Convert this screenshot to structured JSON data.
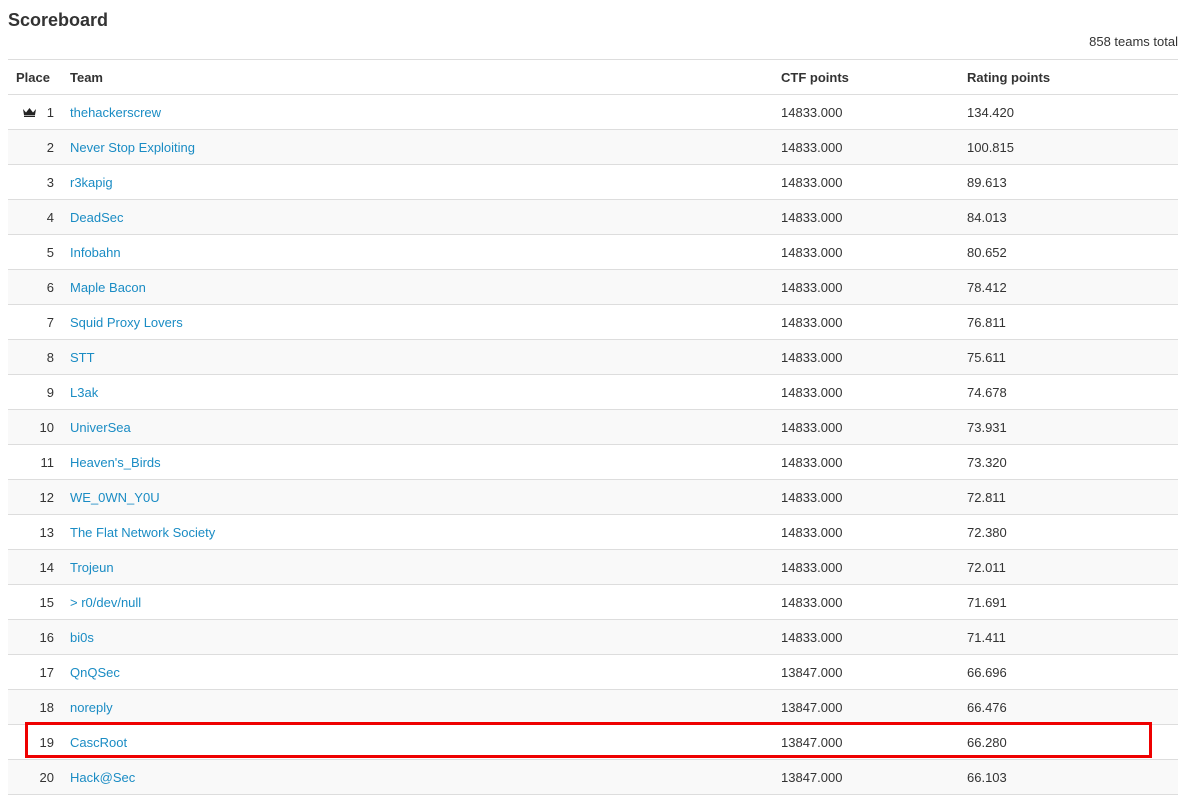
{
  "page": {
    "title": "Scoreboard",
    "teams_total": "858 teams total"
  },
  "colors": {
    "link": "#1a8cc4",
    "highlight": "#ee0000",
    "row_stripe": "#f9f9f9",
    "border": "#dddddd"
  },
  "table": {
    "headers": {
      "place": "Place",
      "team": "Team",
      "ctf_points": "CTF points",
      "rating_points": "Rating points"
    },
    "rows": [
      {
        "place": "1",
        "team": "thehackerscrew",
        "ctf": "14833.000",
        "rating": "134.420",
        "icon": "crown-icon"
      },
      {
        "place": "2",
        "team": "Never Stop Exploiting",
        "ctf": "14833.000",
        "rating": "100.815"
      },
      {
        "place": "3",
        "team": "r3kapig",
        "ctf": "14833.000",
        "rating": "89.613"
      },
      {
        "place": "4",
        "team": "DeadSec",
        "ctf": "14833.000",
        "rating": "84.013"
      },
      {
        "place": "5",
        "team": "Infobahn",
        "ctf": "14833.000",
        "rating": "80.652"
      },
      {
        "place": "6",
        "team": "Maple Bacon",
        "ctf": "14833.000",
        "rating": "78.412"
      },
      {
        "place": "7",
        "team": "Squid Proxy Lovers",
        "ctf": "14833.000",
        "rating": "76.811"
      },
      {
        "place": "8",
        "team": "STT",
        "ctf": "14833.000",
        "rating": "75.611"
      },
      {
        "place": "9",
        "team": "L3ak",
        "ctf": "14833.000",
        "rating": "74.678"
      },
      {
        "place": "10",
        "team": "UniverSea",
        "ctf": "14833.000",
        "rating": "73.931"
      },
      {
        "place": "11",
        "team": "Heaven's_Birds",
        "ctf": "14833.000",
        "rating": "73.320"
      },
      {
        "place": "12",
        "team": "WE_0WN_Y0U",
        "ctf": "14833.000",
        "rating": "72.811"
      },
      {
        "place": "13",
        "team": "The Flat Network Society",
        "ctf": "14833.000",
        "rating": "72.380"
      },
      {
        "place": "14",
        "team": "Trojeun",
        "ctf": "14833.000",
        "rating": "72.011"
      },
      {
        "place": "15",
        "team": "> r0/dev/null",
        "ctf": "14833.000",
        "rating": "71.691"
      },
      {
        "place": "16",
        "team": "bi0s",
        "ctf": "14833.000",
        "rating": "71.411"
      },
      {
        "place": "17",
        "team": "QnQSec",
        "ctf": "13847.000",
        "rating": "66.696"
      },
      {
        "place": "18",
        "team": "noreply",
        "ctf": "13847.000",
        "rating": "66.476"
      },
      {
        "place": "19",
        "team": "CascRoot",
        "ctf": "13847.000",
        "rating": "66.280",
        "highlighted": true
      },
      {
        "place": "20",
        "team": "Hack@Sec",
        "ctf": "13847.000",
        "rating": "66.103"
      }
    ]
  }
}
